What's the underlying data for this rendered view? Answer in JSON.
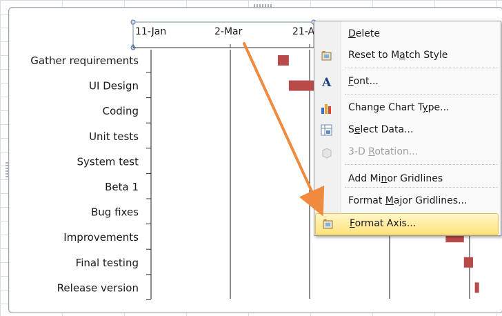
{
  "chart": {
    "axis_ticks": [
      "11-Jan",
      "2-Mar",
      "21-A"
    ],
    "tasks": [
      {
        "label": "Gather requirements",
        "start": 0.68,
        "end": 0.74
      },
      {
        "label": "UI Design",
        "start": 0.74,
        "end": 0.88
      },
      {
        "label": "Coding",
        "start": 0.88,
        "end": 0.97
      },
      {
        "label": "Unit tests",
        "start": null,
        "end": null
      },
      {
        "label": "System test",
        "start": null,
        "end": null
      },
      {
        "label": "Beta 1",
        "start": null,
        "end": null
      },
      {
        "label": "Bug fixes",
        "start": null,
        "end": null
      },
      {
        "label": "Improvements",
        "start": 1.6,
        "end": 1.7
      },
      {
        "label": "Final testing",
        "start": 1.7,
        "end": 1.75
      },
      {
        "label": "Release version",
        "start": 1.76,
        "end": 1.78
      }
    ],
    "bar_color": "#b94a4a",
    "gridline_color": "#1a1a1a"
  },
  "menu": {
    "items": [
      {
        "pre": "",
        "key": "D",
        "post": "elete",
        "icon": "",
        "disabled": false,
        "highlight": false
      },
      {
        "pre": "Reset to M",
        "key": "a",
        "post": "tch Style",
        "icon": "reset-style-icon",
        "disabled": false,
        "highlight": false
      },
      {
        "pre": "",
        "key": "F",
        "post": "ont...",
        "icon": "font-icon",
        "disabled": false,
        "highlight": false
      },
      {
        "pre": "Change Chart T",
        "key": "y",
        "post": "pe...",
        "icon": "chart-type-icon",
        "disabled": false,
        "highlight": false
      },
      {
        "pre": "S",
        "key": "e",
        "post": "lect Data...",
        "icon": "select-data-icon",
        "disabled": false,
        "highlight": false
      },
      {
        "pre": "3-D ",
        "key": "R",
        "post": "otation...",
        "icon": "rotation-icon",
        "disabled": true,
        "highlight": false
      },
      {
        "pre": "Add Mi",
        "key": "n",
        "post": "or Gridlines",
        "icon": "",
        "disabled": false,
        "highlight": false
      },
      {
        "pre": "Format ",
        "key": "M",
        "post": "ajor Gridlines...",
        "icon": "",
        "disabled": false,
        "highlight": false
      },
      {
        "pre": "",
        "key": "F",
        "post": "ormat Axis...",
        "icon": "format-axis-icon",
        "disabled": false,
        "highlight": true
      }
    ]
  },
  "annotation": {
    "arrow_color": "#f08a3e"
  }
}
